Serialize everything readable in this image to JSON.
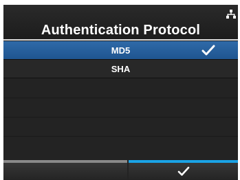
{
  "header": {
    "title": "Authentication Protocol",
    "status_icon": "network-icon"
  },
  "options": [
    {
      "label": "MD5",
      "selected": true
    },
    {
      "label": "SHA",
      "selected": false
    }
  ],
  "softkeys": {
    "left": {
      "label": "",
      "icon": null
    },
    "right": {
      "label": "",
      "icon": "checkmark-icon"
    }
  },
  "colors": {
    "selection": "#2a639f",
    "background": "#222222",
    "confirm_accent": "#1aa3e6",
    "back_accent": "#8a8a8a"
  }
}
